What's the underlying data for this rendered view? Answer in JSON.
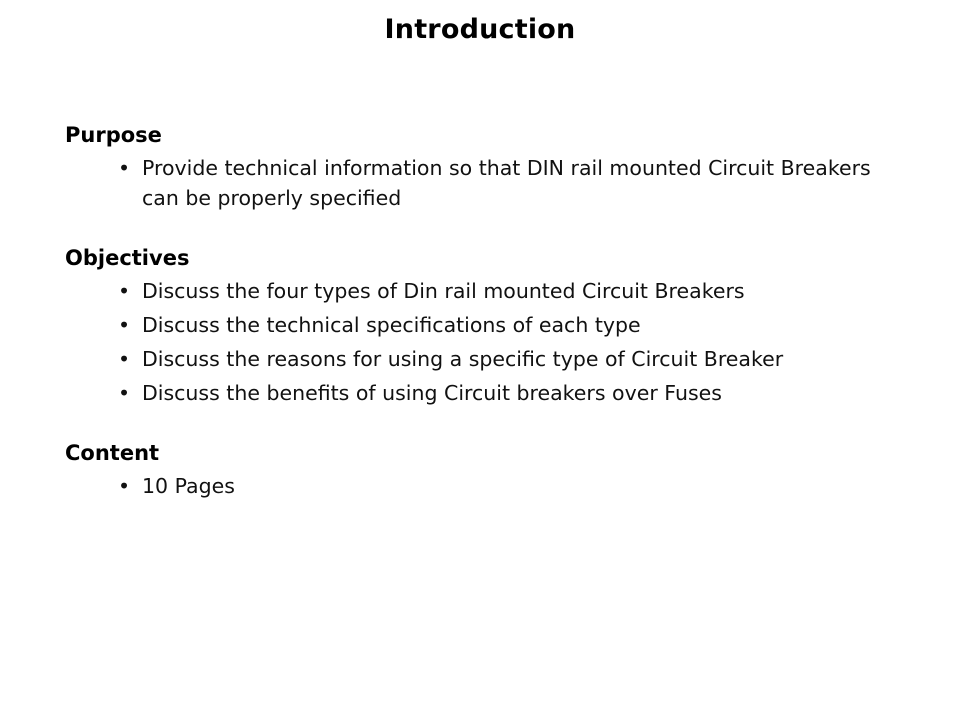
{
  "slide": {
    "title": "Introduction",
    "background_color": "#ffffff",
    "text_color": "#000000",
    "bullet_glyph": "•",
    "sections": [
      {
        "heading": "Purpose",
        "bullets": [
          "Provide technical information so that DIN rail mounted Circuit Breakers can be properly specified"
        ]
      },
      {
        "heading": "Objectives",
        "bullets": [
          "Discuss the four types of Din rail mounted Circuit Breakers",
          "Discuss the technical specifications of each type",
          "Discuss the reasons for using a specific type of Circuit Breaker",
          "Discuss the benefits of using Circuit breakers over Fuses"
        ]
      },
      {
        "heading": "Content",
        "bullets": [
          "10 Pages"
        ]
      }
    ]
  }
}
